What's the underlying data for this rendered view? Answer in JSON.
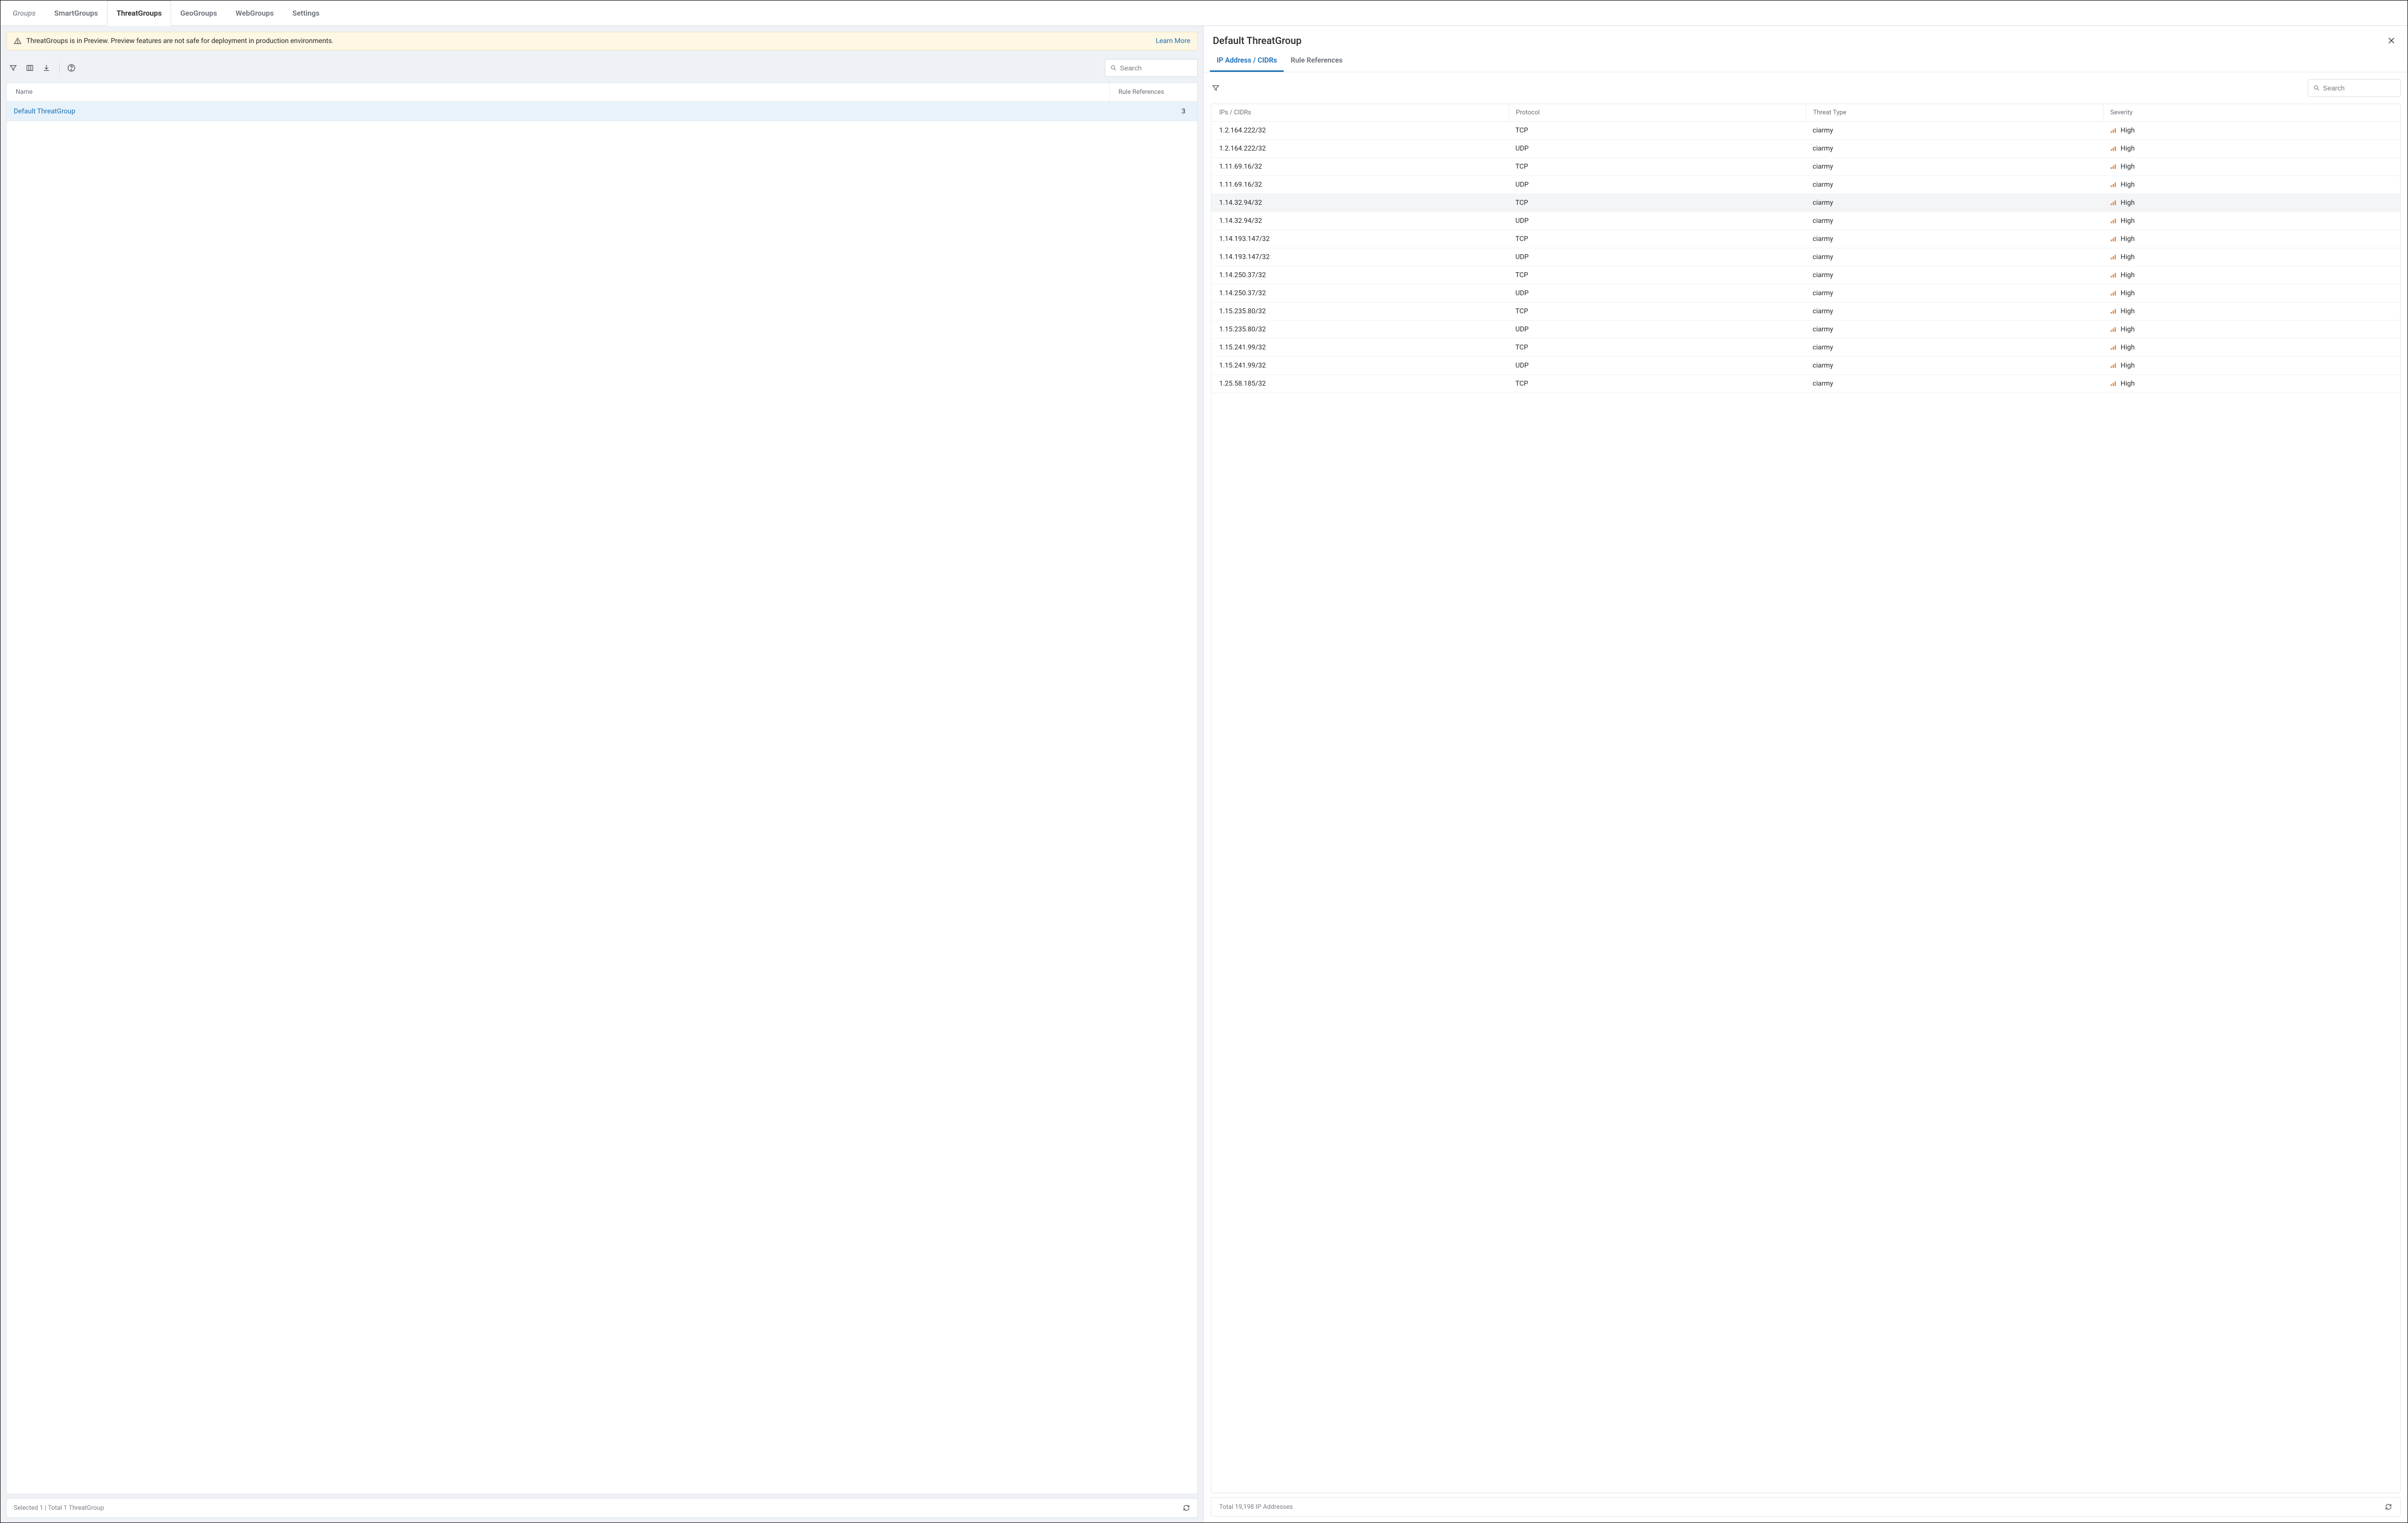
{
  "top_tabs": {
    "groups": "Groups",
    "smartgroups": "SmartGroups",
    "threatgroups": "ThreatGroups",
    "geogroups": "GeoGroups",
    "webgroups": "WebGroups",
    "settings": "Settings"
  },
  "banner": {
    "text": "ThreatGroups is in Preview. Preview features are not safe for deployment in production environments.",
    "learn_more": "Learn More"
  },
  "left": {
    "search_placeholder": "Search",
    "columns": {
      "name": "Name",
      "rule_refs": "Rule References"
    },
    "rows": [
      {
        "name": "Default ThreatGroup",
        "refs": "3"
      }
    ],
    "footer": "Selected 1 | Total 1 ThreatGroup"
  },
  "detail": {
    "title": "Default ThreatGroup",
    "tabs": {
      "ips": "IP Address / CIDRs",
      "refs": "Rule References"
    },
    "search_placeholder": "Search",
    "columns": {
      "ip": "IPs / CIDRs",
      "proto": "Protocol",
      "threat": "Threat Type",
      "sev": "Severity"
    },
    "rows": [
      {
        "ip": "1.2.164.222/32",
        "proto": "TCP",
        "threat": "ciarmy",
        "sev": "High"
      },
      {
        "ip": "1.2.164.222/32",
        "proto": "UDP",
        "threat": "ciarmy",
        "sev": "High"
      },
      {
        "ip": "1.11.69.16/32",
        "proto": "TCP",
        "threat": "ciarmy",
        "sev": "High"
      },
      {
        "ip": "1.11.69.16/32",
        "proto": "UDP",
        "threat": "ciarmy",
        "sev": "High"
      },
      {
        "ip": "1.14.32.94/32",
        "proto": "TCP",
        "threat": "ciarmy",
        "sev": "High",
        "hovered": true
      },
      {
        "ip": "1.14.32.94/32",
        "proto": "UDP",
        "threat": "ciarmy",
        "sev": "High"
      },
      {
        "ip": "1.14.193.147/32",
        "proto": "TCP",
        "threat": "ciarmy",
        "sev": "High"
      },
      {
        "ip": "1.14.193.147/32",
        "proto": "UDP",
        "threat": "ciarmy",
        "sev": "High"
      },
      {
        "ip": "1.14.250.37/32",
        "proto": "TCP",
        "threat": "ciarmy",
        "sev": "High"
      },
      {
        "ip": "1.14.250.37/32",
        "proto": "UDP",
        "threat": "ciarmy",
        "sev": "High"
      },
      {
        "ip": "1.15.235.80/32",
        "proto": "TCP",
        "threat": "ciarmy",
        "sev": "High"
      },
      {
        "ip": "1.15.235.80/32",
        "proto": "UDP",
        "threat": "ciarmy",
        "sev": "High"
      },
      {
        "ip": "1.15.241.99/32",
        "proto": "TCP",
        "threat": "ciarmy",
        "sev": "High"
      },
      {
        "ip": "1.15.241.99/32",
        "proto": "UDP",
        "threat": "ciarmy",
        "sev": "High"
      },
      {
        "ip": "1.25.58.185/32",
        "proto": "TCP",
        "threat": "ciarmy",
        "sev": "High"
      }
    ],
    "footer": "Total 19,198 IP Addresses"
  }
}
